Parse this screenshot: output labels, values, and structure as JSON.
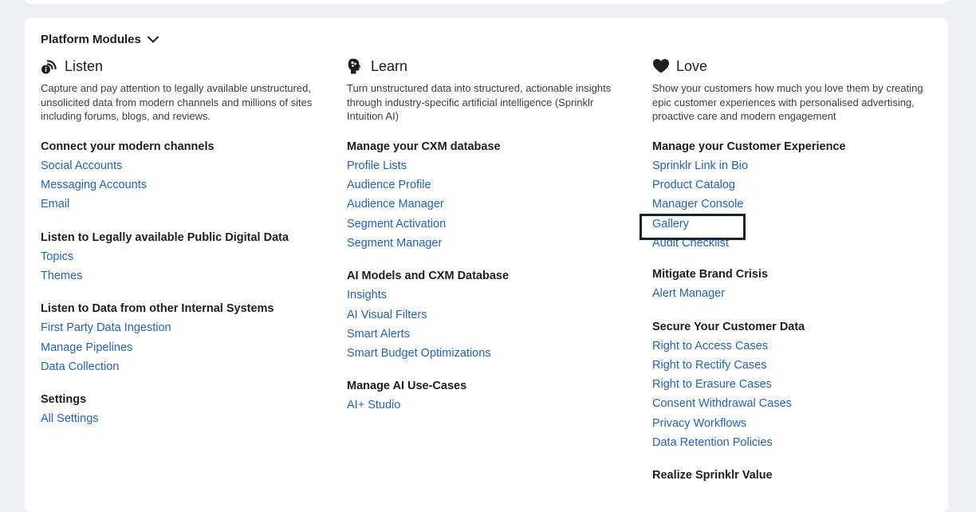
{
  "page": {
    "section_title": "Platform Modules"
  },
  "listen": {
    "title": "Listen",
    "description": "Capture and pay attention to legally available unstructured, unsolicited data from modern channels and millions of sites including forums, blogs, and reviews.",
    "groups": [
      {
        "title": "Connect your modern channels",
        "links": [
          "Social Accounts",
          "Messaging Accounts",
          "Email"
        ]
      },
      {
        "title": "Listen to Legally available Public Digital Data",
        "links": [
          "Topics",
          "Themes"
        ]
      },
      {
        "title": "Listen to Data from other Internal Systems",
        "links": [
          "First Party Data Ingestion",
          "Manage Pipelines",
          "Data Collection"
        ]
      },
      {
        "title": "Settings",
        "links": [
          "All Settings"
        ]
      }
    ]
  },
  "learn": {
    "title": "Learn",
    "description": "Turn unstructured data into structured, actionable insights through industry-specific artificial intelligence (Sprinklr Intuition AI)",
    "groups": [
      {
        "title": "Manage your CXM database",
        "links": [
          "Profile Lists",
          "Audience Profile",
          "Audience Manager",
          "Segment Activation",
          "Segment Manager"
        ]
      },
      {
        "title": "AI Models and CXM Database",
        "links": [
          "Insights",
          "AI Visual Filters",
          "Smart Alerts",
          "Smart Budget Optimizations"
        ]
      },
      {
        "title": "Manage AI Use-Cases",
        "links": [
          "AI+ Studio"
        ]
      }
    ]
  },
  "love": {
    "title": "Love",
    "description": "Show your customers how much you love them by creating epic customer experiences with personalised advertising, proactive care and modern engagement",
    "groups": [
      {
        "title": "Manage your Customer Experience",
        "links": [
          "Sprinklr Link in Bio",
          "Product Catalog",
          "Manager Console",
          "Gallery",
          "Audit Checklist"
        ]
      },
      {
        "title": "Mitigate Brand Crisis",
        "links": [
          "Alert Manager"
        ]
      },
      {
        "title": "Secure Your Customer Data",
        "links": [
          "Right to Access Cases",
          "Right to Rectify Cases",
          "Right to Erasure Cases",
          "Consent Withdrawal Cases",
          "Privacy Workflows",
          "Data Retention Policies"
        ]
      },
      {
        "title": "Realize Sprinklr Value",
        "links": []
      }
    ]
  },
  "colors": {
    "link": "#2261c9",
    "background": "#eef0f3",
    "card": "#ffffff",
    "highlight": "#0f2530"
  },
  "icons": {
    "listen": "broadcast-info-icon",
    "learn": "brain-head-icon",
    "love": "heart-icon",
    "section_toggle": "chevron-down-icon"
  }
}
